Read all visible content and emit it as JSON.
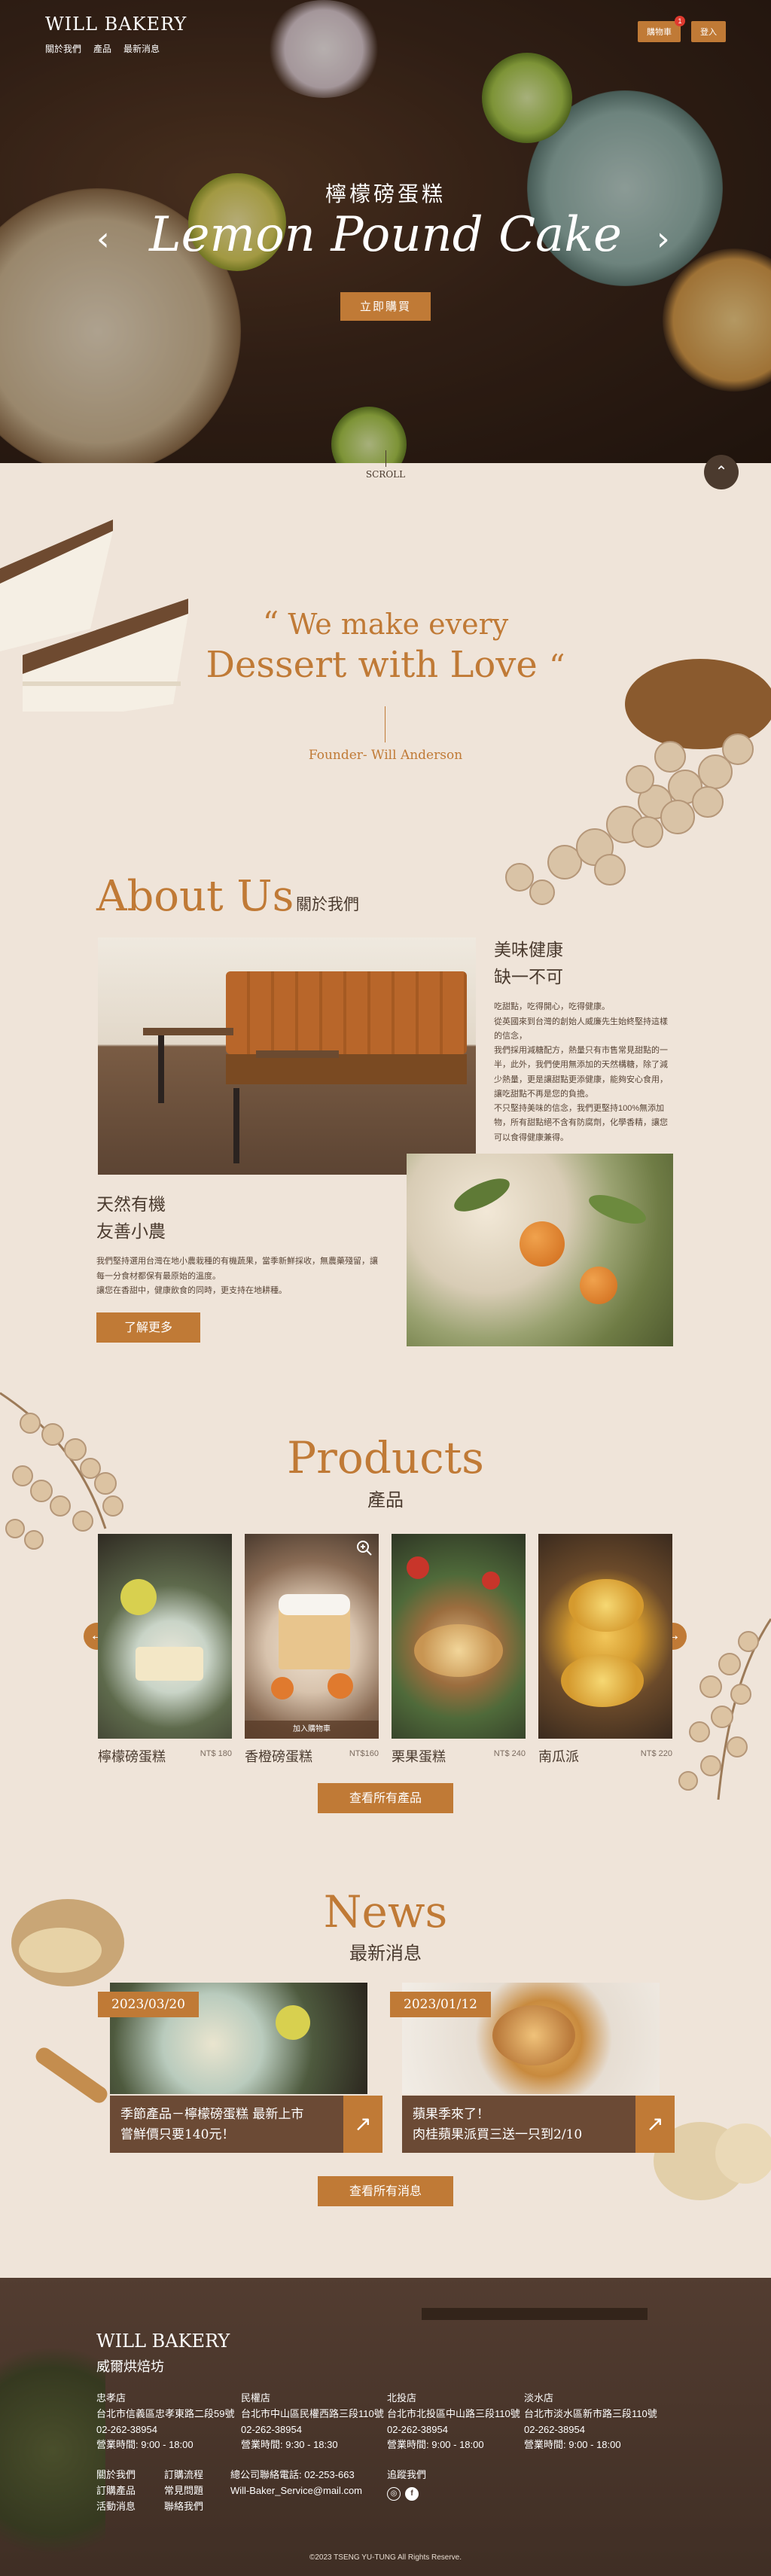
{
  "header": {
    "logo": "WILL BAKERY",
    "nav": [
      "關於我們",
      "產品",
      "最新消息"
    ],
    "cart_label": "購物車",
    "cart_count": "1",
    "login_label": "登入"
  },
  "hero": {
    "subtitle": "檸檬磅蛋糕",
    "title": "Lemon Pound Cake",
    "cta": "立即購買",
    "prev_glyph": "‹",
    "next_glyph": "›",
    "scroll_label": "SCROLL",
    "back_top_glyph": "⌃"
  },
  "quote": {
    "line1": "We make every",
    "line2": "Dessert with Love",
    "open_mark": "“",
    "close_mark": "“",
    "author": "Founder- Will Anderson"
  },
  "about": {
    "title": "About Us",
    "subtitle": "關於我們",
    "block1": {
      "heading1": "美味健康",
      "heading2": "缺一不可",
      "body": [
        "吃甜點，吃得開心，吃得健康。",
        "從英國來到台灣的創始人威廉先生始終堅持這樣的信念，",
        "我們採用減糖配方，熱量只有市售常見甜點的一半，此外，我們使用無添加的天然構糖，除了減少熱量，更是讓甜點更添健康，能夠安心食用，讓吃甜點不再是您的負擔。",
        "不只堅持美味的信念，我們更堅持100%無添加物，所有甜點絕不含有防腐劑，化學香精，讓您可以食得健康兼得。"
      ]
    },
    "block2": {
      "heading1": "天然有機",
      "heading2": "友善小農",
      "body": [
        "我們堅持選用台灣在地小農栽種的有機蔬果，當季新鮮採收，無農藥殘留，讓每一分食材都保有最原始的溫度。",
        "讓您在香甜中，健康飲食的同時，更支持在地耕種。"
      ]
    },
    "more_button": "了解更多"
  },
  "products": {
    "title": "Products",
    "subtitle": "產品",
    "prev_glyph": "←",
    "next_glyph": "→",
    "add_to_cart": "加入購物車",
    "items": [
      {
        "name": "檸檬磅蛋糕",
        "price": "NT$ 180"
      },
      {
        "name": "香橙磅蛋糕",
        "price": "NT$160"
      },
      {
        "name": "栗果蛋糕",
        "price": "NT$ 240"
      },
      {
        "name": "南瓜派",
        "price": "NT$ 220"
      }
    ],
    "all_button": "查看所有產品"
  },
  "news": {
    "title": "News",
    "subtitle": "最新消息",
    "items": [
      {
        "date": "2023/03/20",
        "line1": "季節產品－檸檬磅蛋糕 最新上市",
        "line2": "嘗鮮價只要140元！"
      },
      {
        "date": "2023/01/12",
        "line1": "蘋果季來了！",
        "line2": "肉桂蘋果派買三送一只到2/10"
      }
    ],
    "arrow_glyph": "↗",
    "all_button": "查看所有消息"
  },
  "footer": {
    "logo": "WILL BAKERY",
    "logo_sub": "威爾烘焙坊",
    "stores": [
      {
        "name": "忠孝店",
        "address": "台北市信義區忠孝東路二段59號",
        "phone": "02-262-38954",
        "hours": "營業時間: 9:00 - 18:00"
      },
      {
        "name": "民權店",
        "address": "台北市中山區民權西路三段110號",
        "phone": "02-262-38954",
        "hours": "營業時間: 9:30 - 18:30"
      },
      {
        "name": "北投店",
        "address": "台北市北投區中山路三段110號",
        "phone": "02-262-38954",
        "hours": "營業時間: 9:00 - 18:00"
      },
      {
        "name": "淡水店",
        "address": "台北市淡水區新市路三段110號",
        "phone": "02-262-38954",
        "hours": "營業時間: 9:00 - 18:00"
      }
    ],
    "links_col1": [
      "關於我們",
      "訂購產品",
      "活動消息"
    ],
    "links_col2": [
      "訂購流程",
      "常見問題",
      "聯絡我們"
    ],
    "contact_phone": "總公司聯絡電話: 02-253-663",
    "contact_email": "Will-Baker_Service@mail.com",
    "follow_label": "追蹤我們",
    "copyright": "©2023 TSENG YU-TUNG All Rights Reserve."
  },
  "colors": {
    "accent": "#c07a36",
    "background": "#efe4d9",
    "footer": "#4d3a30",
    "text": "#4a3a2e"
  }
}
